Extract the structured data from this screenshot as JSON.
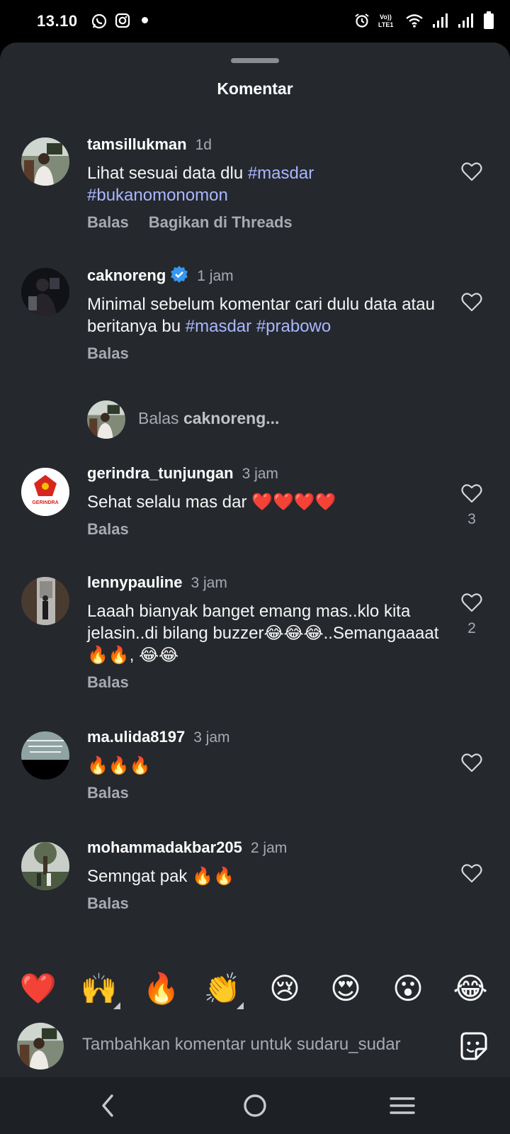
{
  "status": {
    "time": "13.10",
    "network_label": "LTE1"
  },
  "sheet": {
    "title": "Komentar"
  },
  "comments": [
    {
      "username": "tamsillukman",
      "time": "1d",
      "text_parts": [
        "Lihat sesuai data dlu ",
        "#masdar",
        "#bukanomonomon"
      ],
      "actions": [
        "Balas",
        "Bagikan di Threads"
      ],
      "likes": ""
    },
    {
      "username": "caknoreng",
      "verified": true,
      "time": "1 jam",
      "text_plain": "Minimal sebelum komentar cari dulu data atau beritanya bu ",
      "tags": [
        "#masdar",
        "#prabowo"
      ],
      "actions": [
        "Balas"
      ],
      "likes": ""
    },
    {
      "username": "gerindra_tunjungan",
      "time": "3 jam",
      "text": "Sehat selalu mas dar ❤️❤️❤️❤️",
      "actions": [
        "Balas"
      ],
      "likes": "3",
      "avatar_label": "GERINDRA"
    },
    {
      "username": "lennypauline",
      "time": "3 jam",
      "text": "Laaah bianyak banget emang mas..klo kita jelasin..di bilang buzzer😂😂😂..Semangaaaat🔥🔥, 😂😂",
      "actions": [
        "Balas"
      ],
      "likes": "2"
    },
    {
      "username": "ma.ulida8197",
      "time": "3 jam",
      "text": "🔥🔥🔥",
      "actions": [
        "Balas"
      ],
      "likes": ""
    },
    {
      "username": "mohammadakbar205",
      "time": "2 jam",
      "text": "Semngat pak 🔥🔥",
      "actions": [
        "Balas"
      ],
      "likes": ""
    }
  ],
  "reply_prompt": {
    "prefix": "Balas ",
    "target": "caknoreng..."
  },
  "quick_emojis": [
    "❤️",
    "🙌",
    "🔥",
    "👏",
    "😢",
    "😍",
    "😮",
    "😂"
  ],
  "composer": {
    "placeholder": "Tambahkan komentar untuk sudaru_sudar"
  },
  "icons": [
    "whatsapp-icon",
    "instagram-icon",
    "alarm-icon",
    "wifi-icon",
    "signal-icon",
    "battery-icon",
    "heart-icon",
    "verified-icon",
    "sticker-icon",
    "back-icon",
    "home-icon",
    "recents-icon"
  ],
  "colors": {
    "sheet_bg": "#25282d",
    "hashtag": "#a9b7ff",
    "muted": "#a7abb1",
    "verified": "#3897f0",
    "gerindra_red": "#d7261e"
  }
}
